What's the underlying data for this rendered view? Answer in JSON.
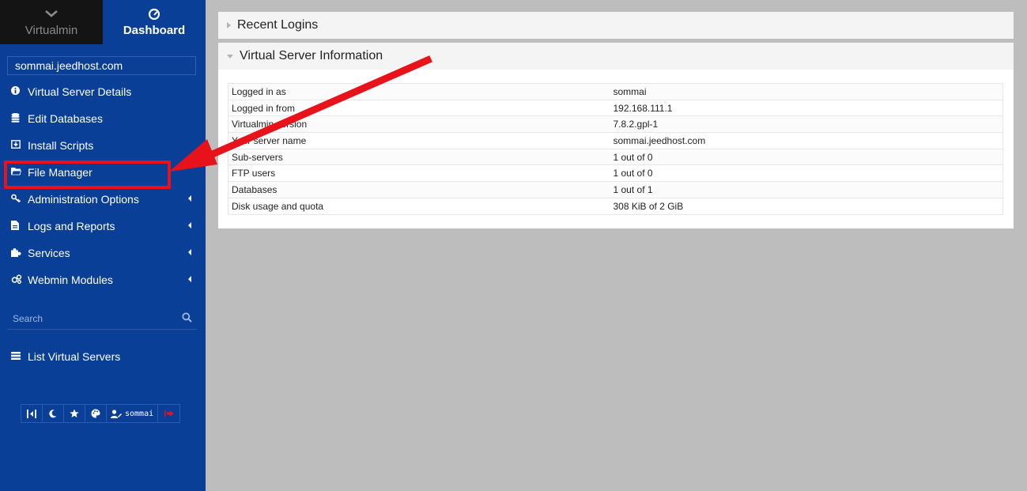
{
  "sidebar": {
    "switch": {
      "virtualmin": "Virtualmin",
      "dashboard": "Dashboard"
    },
    "domain": "sommai.jeedhost.com",
    "items": [
      {
        "label": "Virtual Server Details",
        "icon": "info-circle-icon"
      },
      {
        "label": "Edit Databases",
        "icon": "database-icon"
      },
      {
        "label": "Install Scripts",
        "icon": "download-box-icon"
      },
      {
        "label": "File Manager",
        "icon": "folder-open-icon"
      },
      {
        "label": "Administration Options",
        "icon": "key-icon"
      },
      {
        "label": "Logs and Reports",
        "icon": "file-text-icon"
      },
      {
        "label": "Services",
        "icon": "puzzle-icon"
      },
      {
        "label": "Webmin Modules",
        "icon": "cogs-icon"
      }
    ],
    "search_placeholder": "Search",
    "list_virtual_servers": "List Virtual Servers",
    "toolbar": {
      "user": "sommai"
    }
  },
  "main": {
    "recent_logins": {
      "title": "Recent Logins"
    },
    "vs_info": {
      "title": "Virtual Server Information",
      "rows": [
        {
          "label": "Logged in as",
          "value": "sommai"
        },
        {
          "label": "Logged in from",
          "value": "192.168.111.1"
        },
        {
          "label": "Virtualmin version",
          "value": "7.8.2.gpl-1"
        },
        {
          "label": "Your server name",
          "value": "sommai.jeedhost.com"
        },
        {
          "label": "Sub-servers",
          "value": "1 out of 0"
        },
        {
          "label": "FTP users",
          "value": "1 out of 0"
        },
        {
          "label": "Databases",
          "value": "1 out of 1"
        },
        {
          "label": "Disk usage and quota",
          "value": "308 KiB of 2 GiB"
        }
      ]
    }
  },
  "colors": {
    "sidebar": "#0a3f98",
    "annotation": "#e8121b",
    "background": "#bdbdbd"
  }
}
